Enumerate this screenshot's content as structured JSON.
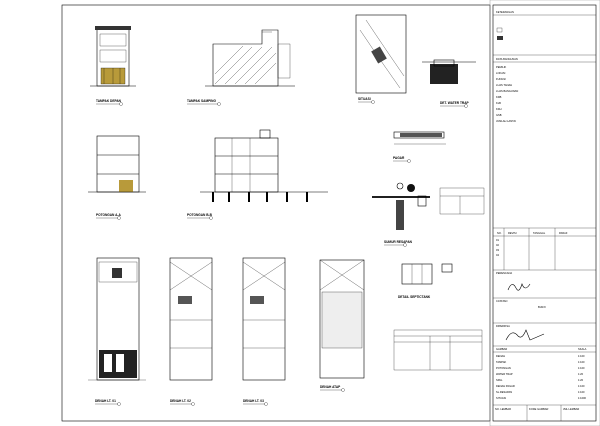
{
  "drawings": {
    "tampak_depan": "TAMPAK DEPAN",
    "tampak_samping": "TAMPAK SAMPING",
    "situasi": "SITUASI",
    "water_trap": "DET. WATER TRAP",
    "potongan_aa": "POTONGAN A-A",
    "potongan_bb": "POTONGAN B-B",
    "pagar": "PAGAR",
    "sumur": "SUMUR RESAPAN",
    "septic": "DETAIL SEPTICTANK",
    "denah_1": "DENAH LT. 01",
    "denah_2": "DENAH LT. 02",
    "denah_3": "DENAH LT. 03",
    "denah_atap": "DENAH ATAP"
  },
  "title_block": {
    "keterangan": "KETERANGAN",
    "data_header": "DATA BANGUNAN",
    "data_rows": [
      "PEMILIK",
      "LOKASI",
      "FUNGSI",
      "LUAS TANAH",
      "LUAS BANGUNAN",
      "KDB",
      "KLB",
      "KDH",
      "GSB",
      "JUMLAH LANTAI"
    ],
    "revisi_header": [
      "NO.",
      "REVISI",
      "TANGGAL",
      "PARAF"
    ],
    "revisi_rows": [
      "01",
      "02",
      "03",
      "04"
    ],
    "perencana": "PERENCANA",
    "catatan": "CATATAN",
    "catatan_title": "BURJI",
    "diperiksa": "DIPERIKSA",
    "gambar_header": "GAMBAR",
    "skala_header": "SKALA",
    "gambar_rows": [
      {
        "name": "DENAH",
        "scale": "1:100"
      },
      {
        "name": "TAMPAK",
        "scale": "1:100"
      },
      {
        "name": "POTONGAN",
        "scale": "1:100"
      },
      {
        "name": "WATER TRAP",
        "scale": "1:20"
      },
      {
        "name": "SPAL",
        "scale": "1:20"
      },
      {
        "name": "DENAH PAGAR",
        "scale": "1:100"
      },
      {
        "name": "SL.RESAPAN",
        "scale": "1:100"
      },
      {
        "name": "SITUASI",
        "scale": "1:1000"
      }
    ],
    "footer": [
      "NO. LEMBAR",
      "KODE GAMBAR",
      "JML LEMBAR"
    ]
  }
}
